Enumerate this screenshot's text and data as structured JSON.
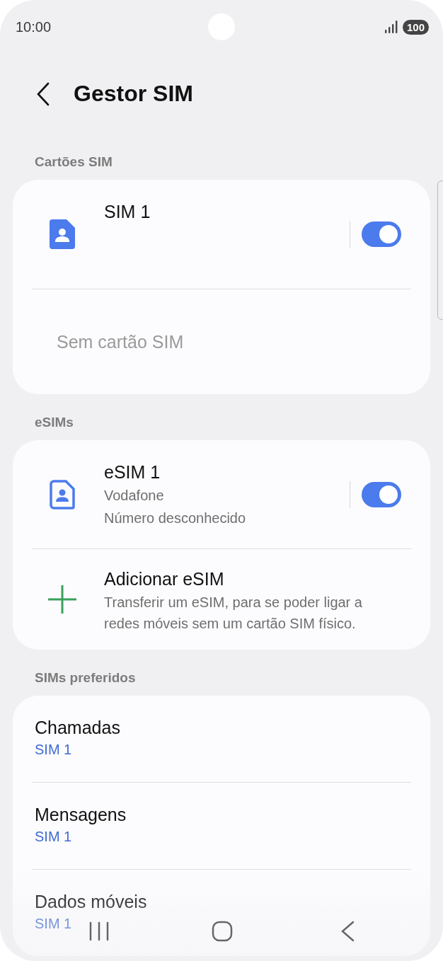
{
  "status_bar": {
    "time": "10:00",
    "battery": "100"
  },
  "header": {
    "title": "Gestor SIM"
  },
  "sections": [
    {
      "title": "Cartões SIM",
      "items": [
        {
          "kind": "sim",
          "title": "SIM 1",
          "on": true
        },
        {
          "kind": "empty",
          "title": "Sem cartão SIM"
        }
      ]
    },
    {
      "title": "eSIMs",
      "items": [
        {
          "kind": "esim",
          "title": "eSIM 1",
          "lines": [
            "Vodafone",
            "Número desconhecido"
          ],
          "on": true
        },
        {
          "kind": "add",
          "title": "Adicionar eSIM",
          "lines": [
            "Transferir um eSIM, para se poder ligar a redes móveis sem um cartão SIM físico."
          ]
        }
      ]
    },
    {
      "title": "SIMs preferidos",
      "items": [
        {
          "kind": "pref",
          "title": "Chamadas",
          "value": "SIM 1"
        },
        {
          "kind": "pref",
          "title": "Mensagens",
          "value": "SIM 1"
        },
        {
          "kind": "pref",
          "title": "Dados móveis",
          "value": "SIM 1"
        }
      ]
    }
  ]
}
